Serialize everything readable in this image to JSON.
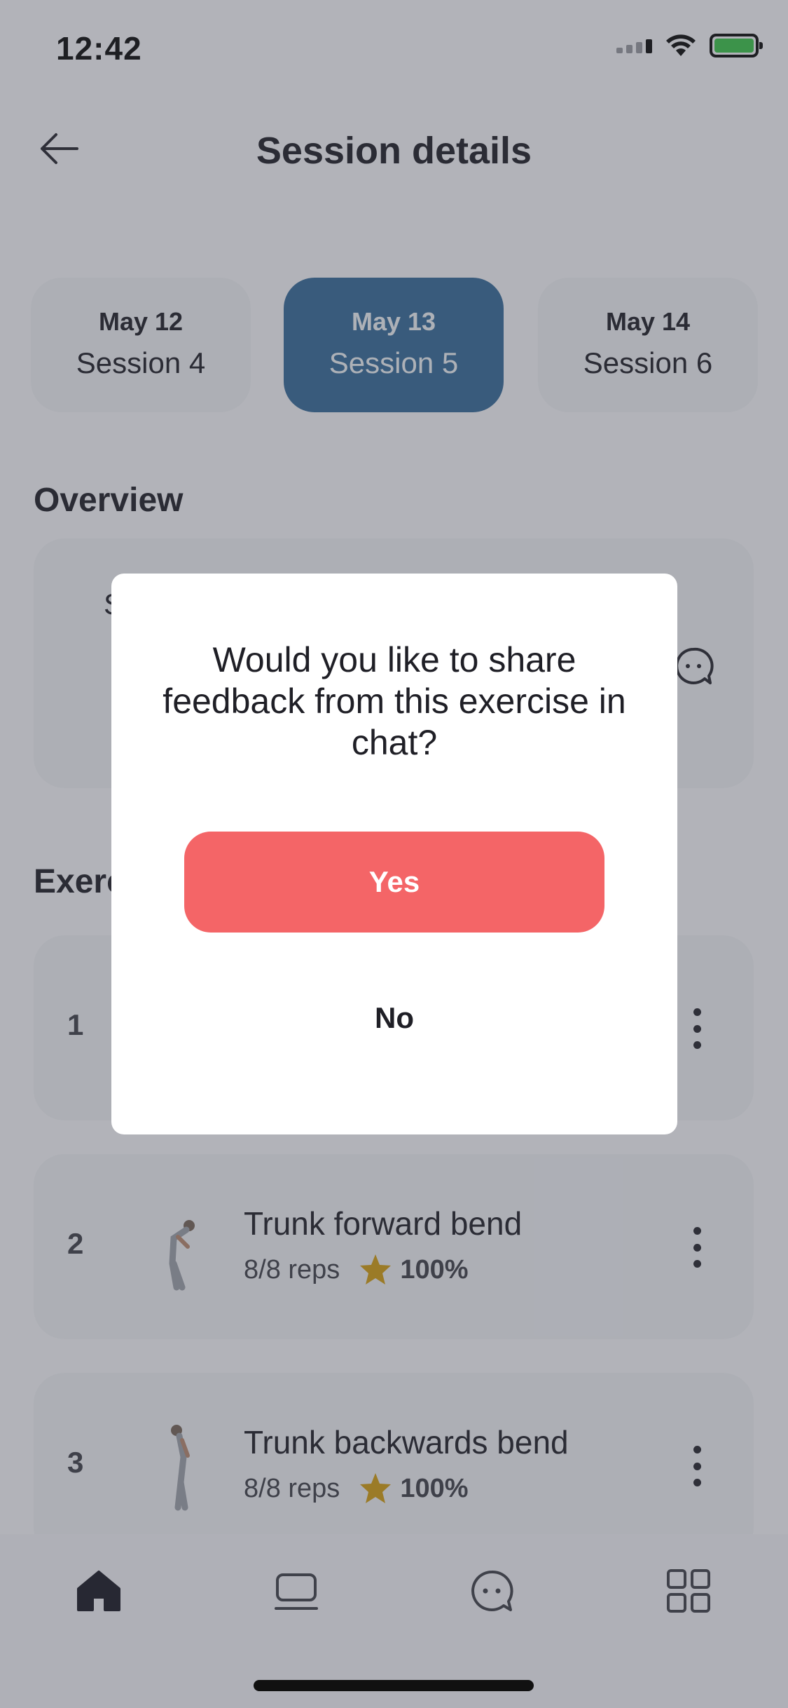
{
  "status_bar": {
    "time": "12:42"
  },
  "header": {
    "title": "Session details"
  },
  "sessions": [
    {
      "date": "May 12",
      "name": "Session 4",
      "active": false
    },
    {
      "date": "May 13",
      "name": "Session 5",
      "active": true
    },
    {
      "date": "May 14",
      "name": "Session 6",
      "active": false
    }
  ],
  "overview": {
    "title": "Overview",
    "partial_letter": "S"
  },
  "exercises_section": {
    "title_visible": "Exerc"
  },
  "exercises": [
    {
      "number": "1"
    },
    {
      "number": "2",
      "name": "Trunk forward bend",
      "reps": "8/8 reps",
      "score": "100%"
    },
    {
      "number": "3",
      "name": "Trunk backwards bend",
      "reps": "8/8 reps",
      "score": "100%"
    }
  ],
  "dialog": {
    "message": "Would you like to share feedback from this exercise in chat?",
    "yes_label": "Yes",
    "no_label": "No"
  },
  "colors": {
    "accent": "#3b6e9c",
    "primary_button": "#f46567",
    "star": "#d4a017"
  },
  "icons": {
    "back": "arrow-left-icon",
    "overview_chat": "chat-bubble-icon",
    "nav": [
      "home-icon",
      "laptop-icon",
      "chat-icon",
      "grid-icon"
    ]
  }
}
